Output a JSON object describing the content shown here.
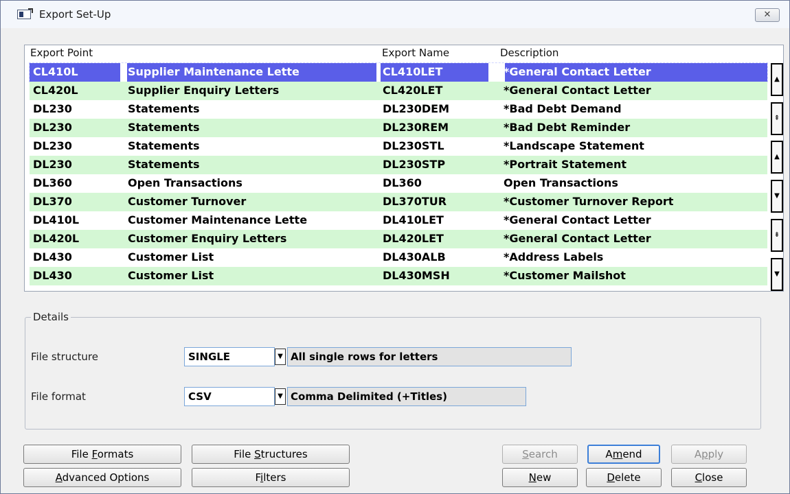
{
  "window": {
    "title": "Export Set-Up",
    "close_label": "✕"
  },
  "grid": {
    "headers": [
      "Export Point",
      "",
      "Export Name",
      "Description"
    ],
    "rows": [
      {
        "point": "CL410L",
        "name": "Supplier Maintenance Lette",
        "export_name": "CL410LET",
        "description": "*General Contact Letter"
      },
      {
        "point": "CL420L",
        "name": "Supplier Enquiry Letters",
        "export_name": "CL420LET",
        "description": "*General Contact Letter"
      },
      {
        "point": "DL230",
        "name": "Statements",
        "export_name": "DL230DEM",
        "description": "*Bad Debt Demand"
      },
      {
        "point": "DL230",
        "name": "Statements",
        "export_name": "DL230REM",
        "description": "*Bad Debt Reminder"
      },
      {
        "point": "DL230",
        "name": "Statements",
        "export_name": "DL230STL",
        "description": "*Landscape Statement"
      },
      {
        "point": "DL230",
        "name": "Statements",
        "export_name": "DL230STP",
        "description": "*Portrait Statement"
      },
      {
        "point": "DL360",
        "name": "Open Transactions",
        "export_name": "DL360",
        "description": "Open Transactions"
      },
      {
        "point": "DL370",
        "name": "Customer Turnover",
        "export_name": "DL370TUR",
        "description": "*Customer Turnover Report"
      },
      {
        "point": "DL410L",
        "name": "Customer Maintenance Lette",
        "export_name": "DL410LET",
        "description": "*General Contact Letter"
      },
      {
        "point": "DL420L",
        "name": "Customer Enquiry Letters",
        "export_name": "DL420LET",
        "description": "*General Contact Letter"
      },
      {
        "point": "DL430",
        "name": "Customer List",
        "export_name": "DL430ALB",
        "description": "*Address Labels"
      },
      {
        "point": "DL430",
        "name": "Customer List",
        "export_name": "DL430MSH",
        "description": "*Customer Mailshot"
      }
    ],
    "selected_row": 0
  },
  "details": {
    "legend": "Details",
    "file_structure_label": "File structure",
    "file_structure_value": "SINGLE",
    "file_structure_desc": "All single rows for letters",
    "file_format_label": "File format",
    "file_format_value": "CSV",
    "file_format_desc": "Comma Delimited (+Titles)"
  },
  "buttons": {
    "file_formats": {
      "pre": "File ",
      "u": "F",
      "post": "ormats"
    },
    "file_structures": {
      "pre": "File ",
      "u": "S",
      "post": "tructures"
    },
    "advanced_options": {
      "pre": "",
      "u": "A",
      "post": "dvanced Options"
    },
    "filters": {
      "pre": "F",
      "u": "i",
      "post": "lters"
    },
    "search": {
      "pre": "",
      "u": "S",
      "post": "earch"
    },
    "amend": {
      "pre": "A",
      "u": "m",
      "post": "end"
    },
    "apply": {
      "pre": "A",
      "u": "p",
      "post": "ply"
    },
    "new": {
      "pre": "",
      "u": "N",
      "post": "ew"
    },
    "delete": {
      "pre": "",
      "u": "D",
      "post": "elete"
    },
    "close": {
      "pre": "",
      "u": "C",
      "post": "lose"
    }
  },
  "icons": {
    "scroll_top": "double-up-arrow",
    "page_up": "page-up",
    "line_up": "up-arrow",
    "line_down": "down-arrow",
    "page_down": "page-down",
    "scroll_bottom": "double-down-arrow",
    "dropdown": "down-arrow"
  }
}
